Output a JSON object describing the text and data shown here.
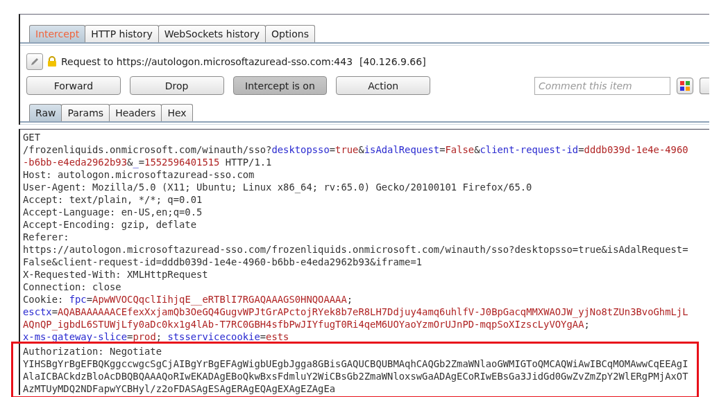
{
  "tabs": [
    {
      "label": "Intercept",
      "selected": true
    },
    {
      "label": "HTTP history",
      "selected": false
    },
    {
      "label": "WebSockets history",
      "selected": false
    },
    {
      "label": "Options",
      "selected": false
    }
  ],
  "request": {
    "label": "Request to https://autologon.microsoftazuread-sso.com:443",
    "ip": "[40.126.9.66]"
  },
  "buttons": [
    {
      "label": "Forward",
      "pressed": false
    },
    {
      "label": "Drop",
      "pressed": false
    },
    {
      "label": "Intercept is on",
      "pressed": true
    },
    {
      "label": "Action",
      "pressed": false
    }
  ],
  "comment": {
    "placeholder": "Comment this item"
  },
  "view_tabs": [
    {
      "label": "Raw",
      "selected": true
    },
    {
      "label": "Params",
      "selected": false
    },
    {
      "label": "Headers",
      "selected": false
    },
    {
      "label": "Hex",
      "selected": false
    }
  ],
  "message": {
    "lines": [
      [
        {
          "kind": "text",
          "text": "GET"
        }
      ],
      [
        {
          "kind": "text",
          "text": "/frozenliquids.onmicrosoft.com/winauth/sso?"
        },
        {
          "kind": "param",
          "text": "desktopsso"
        },
        {
          "kind": "text",
          "text": "="
        },
        {
          "kind": "value",
          "text": "true"
        },
        {
          "kind": "text",
          "text": "&"
        },
        {
          "kind": "param",
          "text": "isAdalRequest"
        },
        {
          "kind": "text",
          "text": "="
        },
        {
          "kind": "value",
          "text": "False"
        },
        {
          "kind": "text",
          "text": "&"
        },
        {
          "kind": "param",
          "text": "client-request-id"
        },
        {
          "kind": "text",
          "text": "="
        },
        {
          "kind": "value",
          "text": "dddb039d-1e4e-4960"
        }
      ],
      [
        {
          "kind": "value",
          "text": "-b6bb-e4eda2962b93"
        },
        {
          "kind": "text",
          "text": "&"
        },
        {
          "kind": "param",
          "text": "_"
        },
        {
          "kind": "text",
          "text": "="
        },
        {
          "kind": "value",
          "text": "1552596401515"
        },
        {
          "kind": "text",
          "text": " HTTP/1.1"
        }
      ],
      [
        {
          "kind": "text",
          "text": "Host: autologon.microsoftazuread-sso.com"
        }
      ],
      [
        {
          "kind": "text",
          "text": "User-Agent: Mozilla/5.0 (X11; Ubuntu; Linux x86_64; rv:65.0) Gecko/20100101 Firefox/65.0"
        }
      ],
      [
        {
          "kind": "text",
          "text": "Accept: text/plain, */*; q=0.01"
        }
      ],
      [
        {
          "kind": "text",
          "text": "Accept-Language: en-US,en;q=0.5"
        }
      ],
      [
        {
          "kind": "text",
          "text": "Accept-Encoding: gzip, deflate"
        }
      ],
      [
        {
          "kind": "text",
          "text": "Referer:"
        }
      ],
      [
        {
          "kind": "text",
          "text": "https://autologon.microsoftazuread-sso.com/frozenliquids.onmicrosoft.com/winauth/sso?desktopsso=true&isAdalRequest="
        }
      ],
      [
        {
          "kind": "text",
          "text": "False&client-request-id=dddb039d-1e4e-4960-b6bb-e4eda2962b93&iframe=1"
        }
      ],
      [
        {
          "kind": "text",
          "text": "X-Requested-With: XMLHttpRequest"
        }
      ],
      [
        {
          "kind": "text",
          "text": "Connection: close"
        }
      ],
      [
        {
          "kind": "text",
          "text": "Cookie: "
        },
        {
          "kind": "param",
          "text": "fpc"
        },
        {
          "kind": "text",
          "text": "="
        },
        {
          "kind": "value",
          "text": "ApwWVOCQqclIihjqE__eRTBlI7RGAQAAAGS0HNQOAAAA"
        },
        {
          "kind": "text",
          "text": ";"
        }
      ],
      [
        {
          "kind": "param",
          "text": "esctx"
        },
        {
          "kind": "text",
          "text": "="
        },
        {
          "kind": "value",
          "text": "AQABAAAAAACEfexXxjamQb3OeGQ4GugvWPJtGrAPctojRYek8b7eR8LH7Ddjuy4amq6uhlfV-J0BpGacqMMXWAOJW_yjNo8tZUn3BvoGhmLjL"
        }
      ],
      [
        {
          "kind": "value",
          "text": "AQnQP_igbdL6STUWjLfy0aDc0kx1g4lAb-T7RC0GBH4sfbPwJIYfugT0Ri4qeM6UOYaoYzmOrUJnPD-mqpSoXIzscLyVOYgAA"
        },
        {
          "kind": "text",
          "text": ";"
        }
      ],
      [
        {
          "kind": "param",
          "text": "x-ms-gateway-slice"
        },
        {
          "kind": "text",
          "text": "="
        },
        {
          "kind": "value",
          "text": "prod"
        },
        {
          "kind": "text",
          "text": "; "
        },
        {
          "kind": "param",
          "text": "stsservicecookie"
        },
        {
          "kind": "text",
          "text": "="
        },
        {
          "kind": "value",
          "text": "ests"
        }
      ]
    ],
    "highlighted_lines": [
      [
        {
          "kind": "text",
          "text": "Authorization: Negotiate"
        }
      ],
      [
        {
          "kind": "text",
          "text": "YIHSBgYrBgEFBQKggccwgcSgCjAIBgYrBgEFAgWigbUEgbJgga8GBisGAQUCBQUBMAqhCAQGb2ZmaWNlaoGWMIGToQMCAQWiAwIBCqMOMAwwCqEEAgI"
        }
      ],
      [
        {
          "kind": "text",
          "text": "AlaICBACkdzBloAcDBQBQAAAQoRIwEKADAgEBoQkwBxsFdmluY2WiCBsGb2ZmaWNloxswGaADAgECoRIwEBsGa3JidGd0GwZvZmZpY2WlERgPMjAxOT"
        }
      ],
      [
        {
          "kind": "text",
          "text": "AzMTUyMDQ2NDFapwYCBHyl/z2oFDASAgESAgERAgEQAgEXAgEZAgEa"
        }
      ]
    ]
  }
}
